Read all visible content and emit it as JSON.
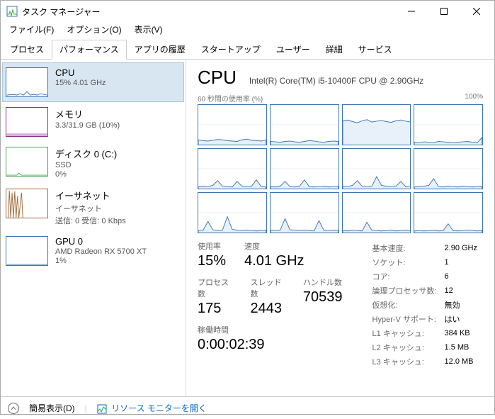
{
  "window": {
    "title": "タスク マネージャー"
  },
  "menu": {
    "file": "ファイル(F)",
    "options": "オプション(O)",
    "view": "表示(V)"
  },
  "tabs": {
    "process": "プロセス",
    "performance": "パフォーマンス",
    "history": "アプリの履歴",
    "startup": "スタートアップ",
    "users": "ユーザー",
    "details": "詳細",
    "services": "サービス"
  },
  "sidebar": {
    "cpu": {
      "name": "CPU",
      "sub": "15%  4.01 GHz"
    },
    "mem": {
      "name": "メモリ",
      "sub": "3.3/31.9 GB (10%)"
    },
    "disk": {
      "name": "ディスク 0 (C:)",
      "sub1": "SSD",
      "sub2": "0%"
    },
    "eth": {
      "name": "イーサネット",
      "sub1": "イーサネット",
      "sub2": "送信: 0 受信: 0 Kbps"
    },
    "gpu": {
      "name": "GPU 0",
      "sub1": "AMD Radeon RX 5700 XT",
      "sub2": "1%"
    }
  },
  "content": {
    "title": "CPU",
    "model": "Intel(R) Core(TM) i5-10400F CPU @ 2.90GHz",
    "axis_left": "60 秒間の使用率 (%)",
    "axis_right": "100%",
    "stats": {
      "usage_lbl": "使用率",
      "usage": "15%",
      "speed_lbl": "速度",
      "speed": "4.01 GHz",
      "proc_lbl": "プロセス数",
      "proc": "175",
      "thread_lbl": "スレッド数",
      "thread": "2443",
      "handle_lbl": "ハンドル数",
      "handle": "70539",
      "uptime_lbl": "稼働時間",
      "uptime": "0:00:02:39"
    },
    "spec": {
      "base_lbl": "基本速度:",
      "base": "2.90 GHz",
      "sock_lbl": "ソケット:",
      "sock": "1",
      "core_lbl": "コア:",
      "core": "6",
      "lproc_lbl": "論理プロセッサ数:",
      "lproc": "12",
      "virt_lbl": "仮想化:",
      "virt": "無効",
      "hv_lbl": "Hyper-V サポート:",
      "hv": "はい",
      "l1_lbl": "L1 キャッシュ:",
      "l1": "384 KB",
      "l2_lbl": "L2 キャッシュ:",
      "l2": "1.5 MB",
      "l3_lbl": "L3 キャッシュ:",
      "l3": "12.0 MB"
    }
  },
  "footer": {
    "simple": "簡易表示(D)",
    "resmon": "リソース モニターを開く"
  },
  "chart_data": {
    "type": "line",
    "description": "12 per-logical-processor utilization sparklines over 60 seconds",
    "ylim": [
      0,
      100
    ],
    "xrange_seconds": 60,
    "series": [
      {
        "name": "CPU0",
        "values": [
          12,
          10,
          9,
          11,
          13,
          12,
          10,
          9,
          8,
          12,
          14,
          11,
          10,
          9,
          12
        ]
      },
      {
        "name": "CPU1",
        "values": [
          8,
          7,
          6,
          8,
          9,
          7,
          6,
          8,
          10,
          9,
          7,
          6,
          8,
          9,
          8
        ]
      },
      {
        "name": "CPU2",
        "values": [
          60,
          62,
          58,
          55,
          60,
          63,
          57,
          59,
          61,
          58,
          56,
          60,
          62,
          59,
          57
        ]
      },
      {
        "name": "CPU3",
        "values": [
          6,
          5,
          7,
          6,
          5,
          8,
          7,
          6,
          5,
          6,
          7,
          8,
          6,
          5,
          18
        ]
      },
      {
        "name": "CPU4",
        "values": [
          4,
          6,
          5,
          8,
          20,
          6,
          5,
          4,
          18,
          6,
          5,
          6,
          22,
          5,
          4
        ]
      },
      {
        "name": "CPU5",
        "values": [
          5,
          4,
          6,
          18,
          5,
          4,
          6,
          22,
          5,
          4,
          5,
          6,
          4,
          5,
          6
        ]
      },
      {
        "name": "CPU6",
        "values": [
          6,
          5,
          8,
          20,
          6,
          5,
          6,
          30,
          8,
          6,
          5,
          6,
          18,
          5,
          6
        ]
      },
      {
        "name": "CPU7",
        "values": [
          4,
          5,
          6,
          8,
          25,
          5,
          4,
          6,
          5,
          4,
          6,
          5,
          4,
          5,
          6
        ]
      },
      {
        "name": "CPU8",
        "values": [
          5,
          6,
          28,
          7,
          5,
          6,
          40,
          8,
          6,
          5,
          6,
          5,
          4,
          5,
          6
        ]
      },
      {
        "name": "CPU9",
        "values": [
          6,
          5,
          6,
          35,
          7,
          6,
          5,
          6,
          5,
          4,
          30,
          6,
          5,
          6,
          5
        ]
      },
      {
        "name": "CPU10",
        "values": [
          5,
          4,
          6,
          5,
          4,
          26,
          6,
          5,
          4,
          5,
          6,
          4,
          5,
          6,
          4
        ]
      },
      {
        "name": "CPU11",
        "values": [
          4,
          5,
          4,
          5,
          6,
          4,
          5,
          22,
          5,
          4,
          5,
          6,
          5,
          4,
          5
        ]
      }
    ]
  }
}
